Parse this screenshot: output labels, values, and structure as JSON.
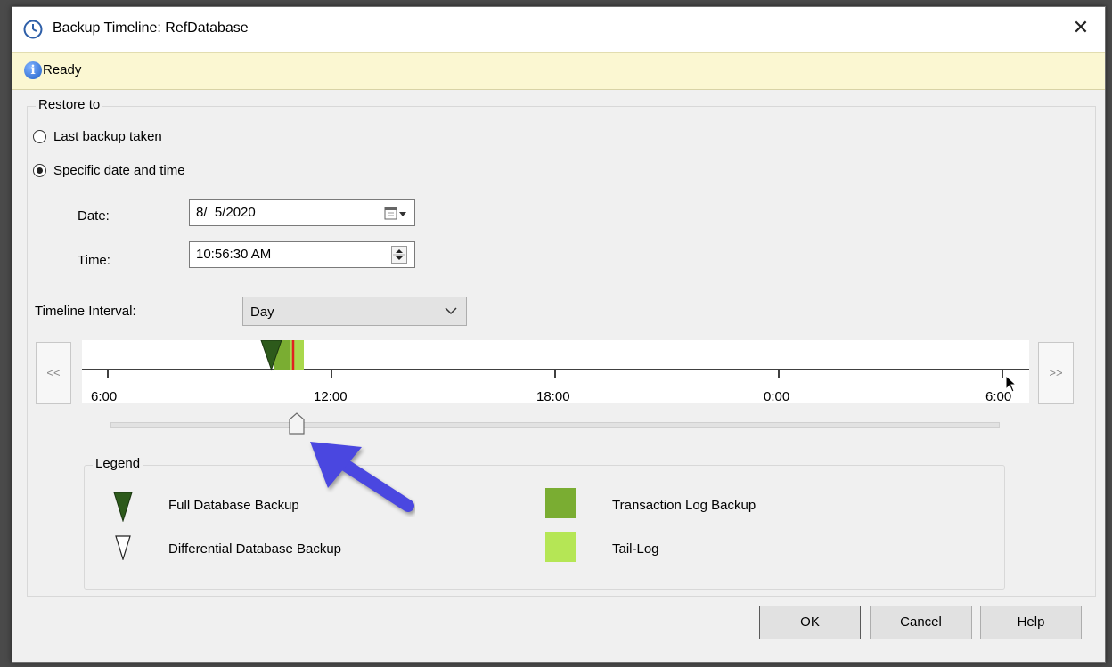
{
  "window": {
    "title": "Backup Timeline: RefDatabase",
    "close_glyph": "✕",
    "icon": "clock-icon"
  },
  "status": {
    "text": "Ready",
    "icon": "info-icon"
  },
  "restore_to": {
    "label": "Restore to",
    "options": [
      {
        "label": "Last backup taken",
        "selected": false
      },
      {
        "label": "Specific date and time",
        "selected": true
      }
    ]
  },
  "date": {
    "label": "Date:",
    "value": "8/  5/2020"
  },
  "time": {
    "label": "Time:",
    "value": "10:56:30 AM"
  },
  "timeline_interval": {
    "label": "Timeline Interval:",
    "value": "Day"
  },
  "timeline": {
    "prev_label": "<<",
    "next_label": ">>",
    "ticks": [
      "6:00",
      "12:00",
      "18:00",
      "0:00",
      "6:00"
    ],
    "slider_position_percent": 21
  },
  "legend": {
    "label": "Legend",
    "items": [
      {
        "label": "Full Database Backup",
        "icon": "full-backup-icon"
      },
      {
        "label": "Differential Database Backup",
        "icon": "differential-backup-icon"
      },
      {
        "label": "Transaction Log Backup",
        "icon": "transaction-log-icon"
      },
      {
        "label": "Tail-Log",
        "icon": "tail-log-icon"
      }
    ]
  },
  "buttons": {
    "ok": "OK",
    "cancel": "Cancel",
    "help": "Help"
  },
  "colors": {
    "full_backup": "#2d5a1b",
    "transaction_log": "#7aad32",
    "tail_log": "#b5e655",
    "restore_marker": "#e02020",
    "status_bg": "#fbf7d2",
    "annotation_arrow": "#4a47e0"
  }
}
